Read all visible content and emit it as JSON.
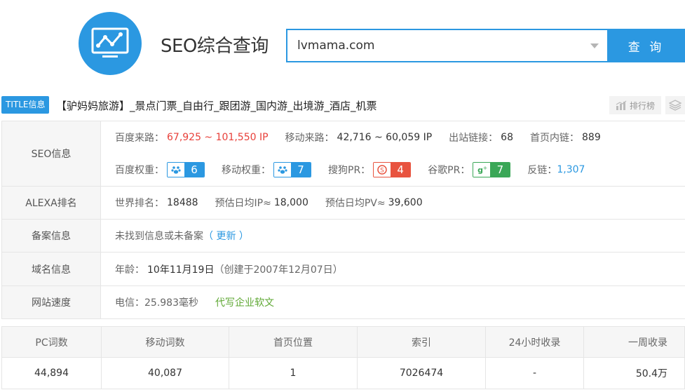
{
  "header": {
    "logo_icon": "line-chart-monitor-icon",
    "title": "SEO综合查询",
    "search_value": "lvmama.com",
    "search_button": "查 询"
  },
  "title_row": {
    "tag": "TITLE信息",
    "text": "【驴妈妈旅游】_景点门票_自由行_跟团游_国内游_出境游_酒店_机票",
    "rank_button": "排行榜"
  },
  "seo": {
    "label": "SEO信息",
    "baidu_traffic_label": "百度来路：",
    "baidu_traffic_value": "67,925 ~ 101,550 IP",
    "mobile_traffic_label": "移动来路：",
    "mobile_traffic_value": "42,716 ~ 60,059 IP",
    "outbound_label": "出站链接：",
    "outbound_value": "68",
    "internal_label": "首页内链：",
    "internal_value": "889",
    "baidu_weight_label": "百度权重：",
    "baidu_weight_value": "6",
    "mobile_weight_label": "移动权重：",
    "mobile_weight_value": "7",
    "sogou_pr_label": "搜狗PR：",
    "sogou_pr_value": "4",
    "google_pr_label": "谷歌PR：",
    "google_pr_value": "7",
    "backlink_label": "反链：",
    "backlink_value": "1,307"
  },
  "alexa": {
    "label": "ALEXA排名",
    "world_rank_label": "世界排名：",
    "world_rank_value": "18488",
    "daily_ip_label": "预估日均IP≈",
    "daily_ip_value": "18,000",
    "daily_pv_label": "预估日均PV≈",
    "daily_pv_value": "39,600"
  },
  "icp": {
    "label": "备案信息",
    "text": "未找到信息或未备案",
    "update_link": "（ 更新 ）"
  },
  "domain": {
    "label": "域名信息",
    "age_label": "年龄：",
    "age_value": "10年11月19日",
    "created": "（创建于2007年12月07日）"
  },
  "speed": {
    "label": "网站速度",
    "value": "电信：25.983毫秒",
    "ad_link": "代写企业软文"
  },
  "stats": {
    "headers": [
      "PC词数",
      "移动词数",
      "首页位置",
      "索引",
      "24小时收录",
      "一周收录"
    ],
    "values": [
      "44,894",
      "40,087",
      "1",
      "7026474",
      "-",
      "50.4万"
    ]
  }
}
